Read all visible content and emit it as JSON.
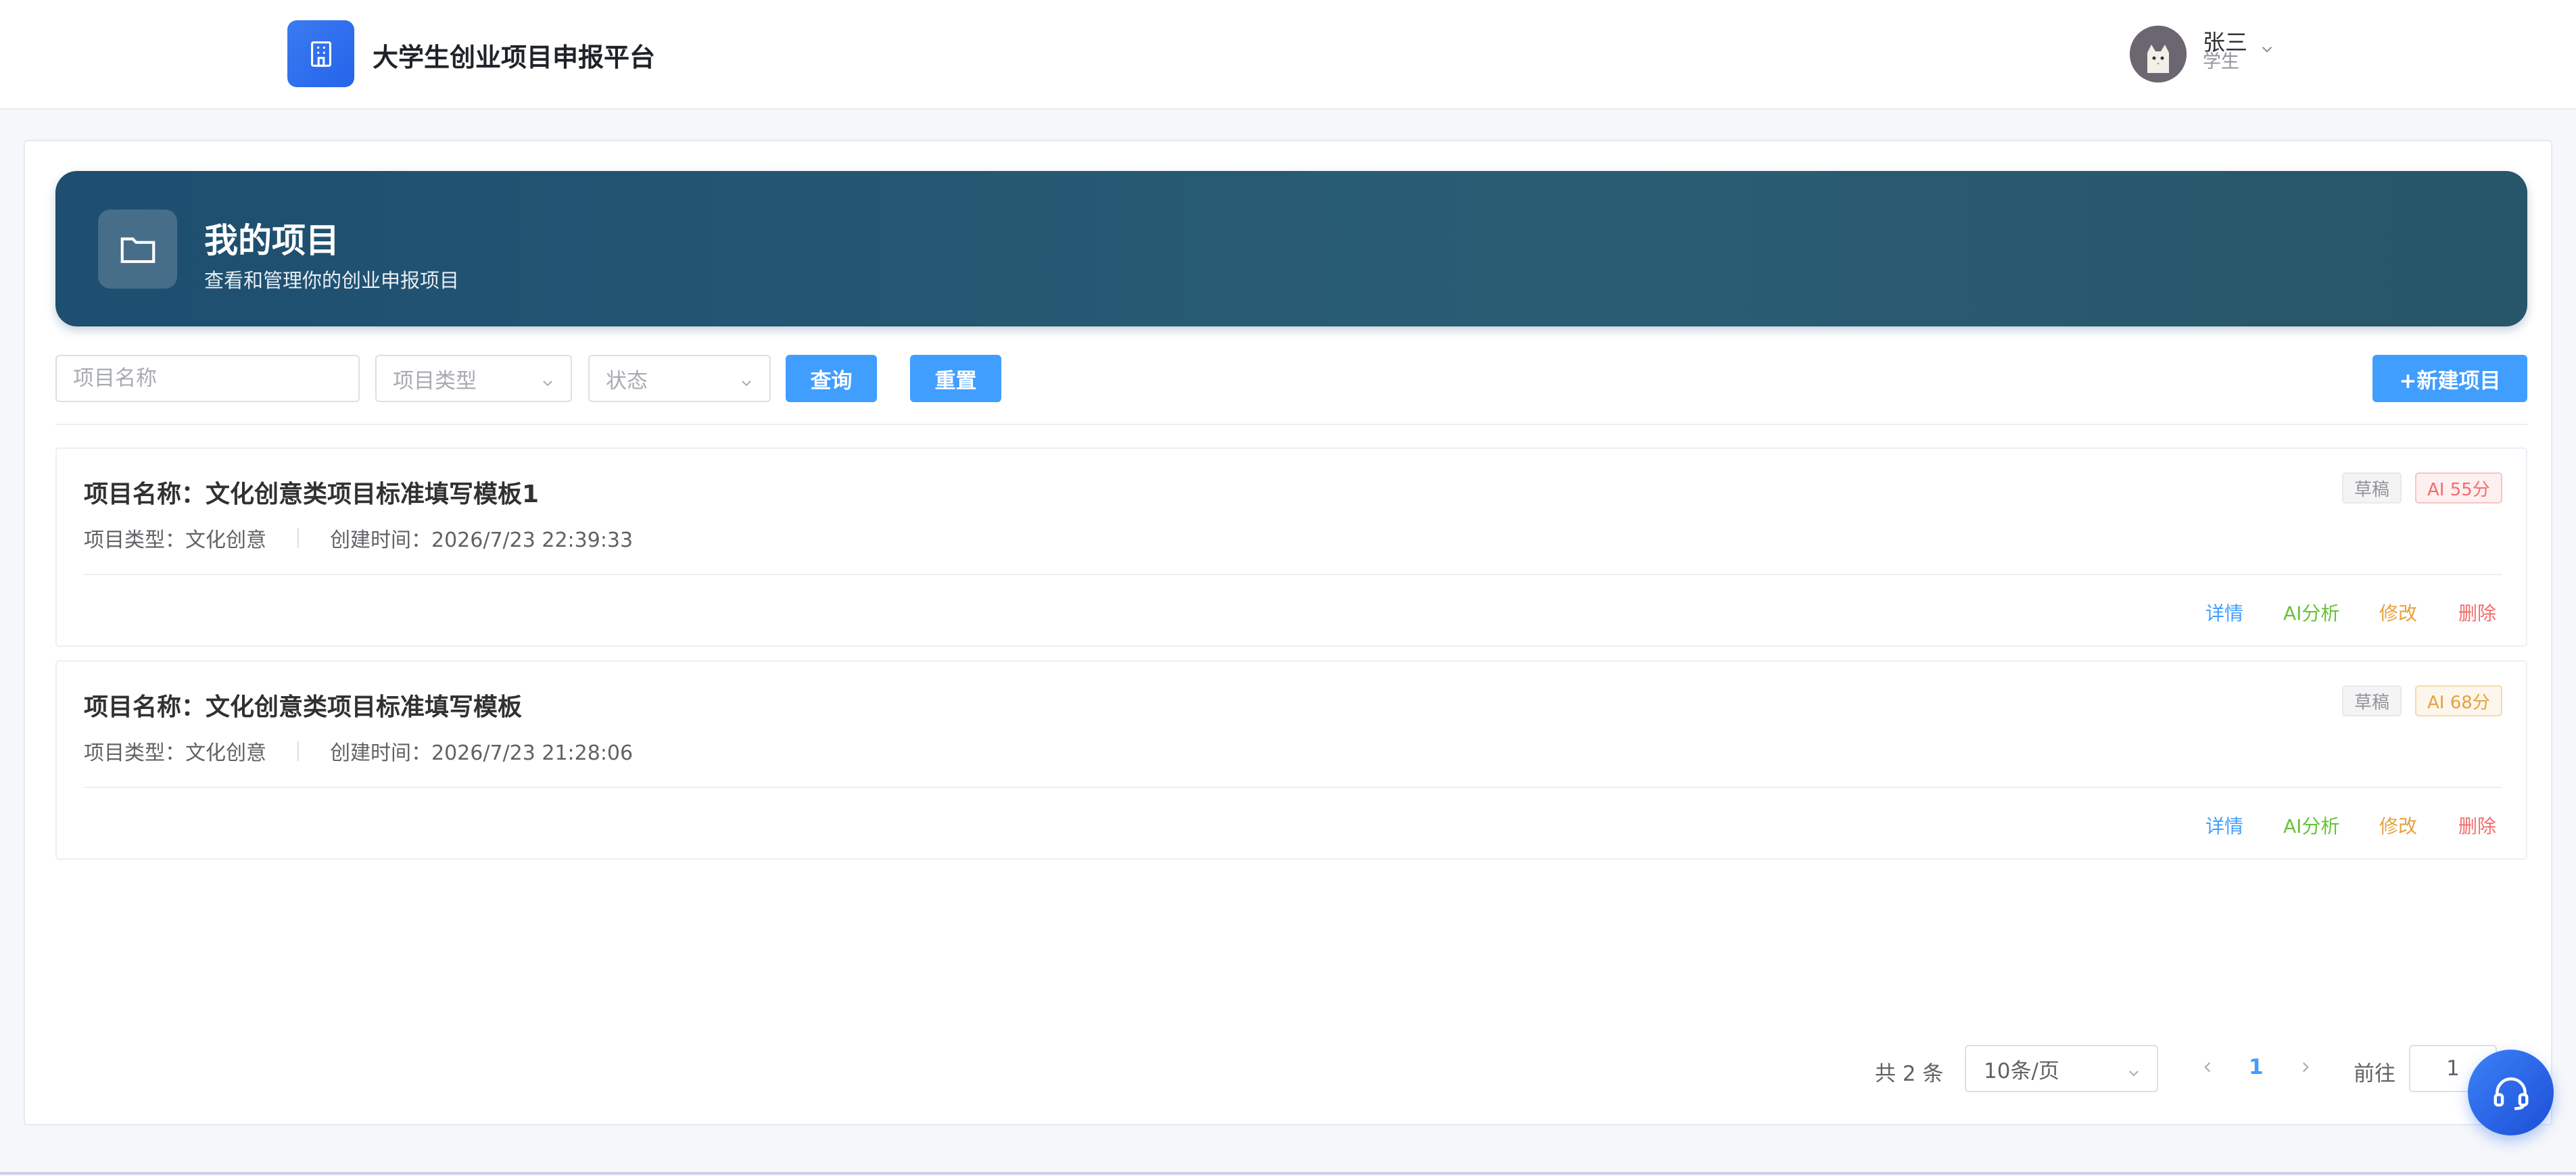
{
  "header": {
    "app_title": "大学生创业项目申报平台",
    "logo_icon": "building-icon",
    "user": {
      "name": "张三",
      "role": "学生",
      "avatar_icon": "cat-avatar-icon"
    }
  },
  "banner": {
    "icon": "folder-icon",
    "title": "我的项目",
    "subtitle": "查看和管理你的创业申报项目"
  },
  "filters": {
    "name_placeholder": "项目名称",
    "type_placeholder": "项目类型",
    "status_placeholder": "状态",
    "query_label": "查询",
    "reset_label": "重置",
    "new_label": "+新建项目"
  },
  "projects": [
    {
      "name": "项目名称：文化创意类项目标准填写模板1",
      "type": "项目类型：文化创意",
      "created": "创建时间：2026/7/23 22:39:33",
      "status": "草稿",
      "ai_score": "AI 55分",
      "actions": {
        "detail": "详情",
        "ai": "AI分析",
        "edit": "修改",
        "delete": "删除"
      }
    },
    {
      "name": "项目名称：文化创意类项目标准填写模板",
      "type": "项目类型：文化创意",
      "created": "创建时间：2026/7/23 21:28:06",
      "status": "草稿",
      "ai_score": "AI 68分",
      "actions": {
        "detail": "详情",
        "ai": "AI分析",
        "edit": "修改",
        "delete": "删除"
      }
    }
  ],
  "pagination": {
    "total": "共 2 条",
    "page_size": "10条/页",
    "current_page": "1",
    "goto_label": "前往",
    "goto_value": "1"
  },
  "fab": {
    "icon": "headset-icon"
  },
  "colors": {
    "primary": "#409eff",
    "banner_start": "#1e4e70",
    "banner_end": "#275569",
    "success": "#67c23a",
    "warning": "#e6a23c",
    "danger": "#f56c6c"
  }
}
